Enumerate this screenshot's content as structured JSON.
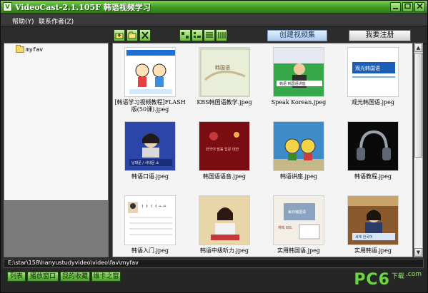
{
  "window": {
    "title": "VideoCast-2.1.105F 韩语视频学习",
    "controls": {
      "minimize": "0",
      "maximize": "1",
      "close": "r"
    }
  },
  "menu": [
    "帮助(Y)",
    "联系作者(Z)"
  ],
  "toolbar": {
    "icons": [
      "folder-up-icon",
      "folder-new-icon",
      "delete-icon",
      "view-large-icon",
      "view-small-icon",
      "view-list-icon",
      "view-detail-icon"
    ],
    "create_album": "创建视频集",
    "register": "我要注册"
  },
  "tree": {
    "folder_name": "myfav"
  },
  "thumbnails": [
    {
      "label": "[韩语学习视频教程]FLASH版(50课).jpeg"
    },
    {
      "label": "KBS韩国语教学.jpeg"
    },
    {
      "label": "Speak Korean.jpeg"
    },
    {
      "label": "观光韩国语.jpeg"
    },
    {
      "label": "韩语口语.jpeg"
    },
    {
      "label": "韩国语语音.jpeg"
    },
    {
      "label": "韩语讲座.jpeg"
    },
    {
      "label": "韩语教程.jpeg"
    },
    {
      "label": "韩语入门.jpeg"
    },
    {
      "label": "韩语中级听力.jpeg"
    },
    {
      "label": "实用韩国语.jpeg"
    },
    {
      "label": "实用韩语.jpeg"
    }
  ],
  "thumb_texts": {
    "t2_title": "韩国语",
    "t3_sub": "韩语 韩国语讲座",
    "t4_title": "观光韩国语",
    "t5_sub": "남대문 / 사대문 소",
    "t6_text": "한국어 발음 입문 대한",
    "t9_grid": "ㅏ ㅑ ㅓ ㅕ ㅗ ㅛ",
    "t11_top": "每日韩国语",
    "t11_left": "재택 화도",
    "t12_caption": "세계 한국어"
  },
  "statusbar": {
    "path": "E:\\star\\158\\hanyustudyvideo\\video\\fav\\myfav"
  },
  "bottom_tabs": [
    "列表",
    "播放窗口",
    "我的收藏",
    "维卡之窗"
  ],
  "watermark": {
    "main": "PC6",
    "sub": "下载",
    "site": ".com"
  }
}
